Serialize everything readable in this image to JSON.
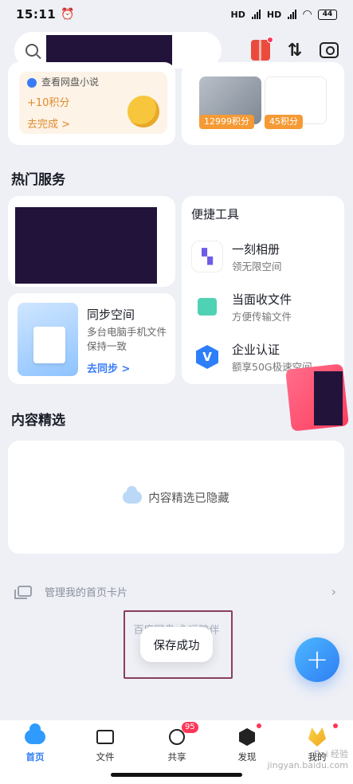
{
  "status_bar": {
    "time": "15:11",
    "battery": "44",
    "signal_1": "HD",
    "signal_2": "HD"
  },
  "task_card": {
    "title": "查看网盘小说",
    "points": "+10积分",
    "action": "去完成 >"
  },
  "reward_card": {
    "price_1": "12999积分",
    "price_2": "45积分"
  },
  "hot_services": {
    "title": "热门服务",
    "sync": {
      "title": "同步空间",
      "desc": "多台电脑手机文件保持一致",
      "action": "去同步 >"
    }
  },
  "quick_tools": {
    "title": "便捷工具",
    "items": [
      {
        "name": "一刻相册",
        "desc": "领无限空间",
        "icon": "album-icon"
      },
      {
        "name": "当面收文件",
        "desc": "方便传输文件",
        "icon": "receive-file-icon"
      },
      {
        "name": "企业认证",
        "desc": "额享50G极速空间",
        "icon": "verify-icon",
        "glyph": "V"
      }
    ]
  },
  "featured": {
    "title": "内容精选",
    "hidden_text": "内容精选已隐藏"
  },
  "manage": {
    "label": "管理我的首页卡片",
    "chevron": "›"
  },
  "slogan": "百度网盘 永远陪伴",
  "toast": "保存成功",
  "fab": "+",
  "tabs": {
    "home": "首页",
    "files": "文件",
    "share": "共享",
    "share_badge": "95",
    "discover": "发现",
    "mine": "我的"
  },
  "watermark": {
    "line1": "Bai 经验",
    "line2": "jingyan.baidu.com"
  },
  "colors": {
    "accent": "#2f7df4",
    "points": "#e08b2c",
    "badge": "#ff3656"
  }
}
